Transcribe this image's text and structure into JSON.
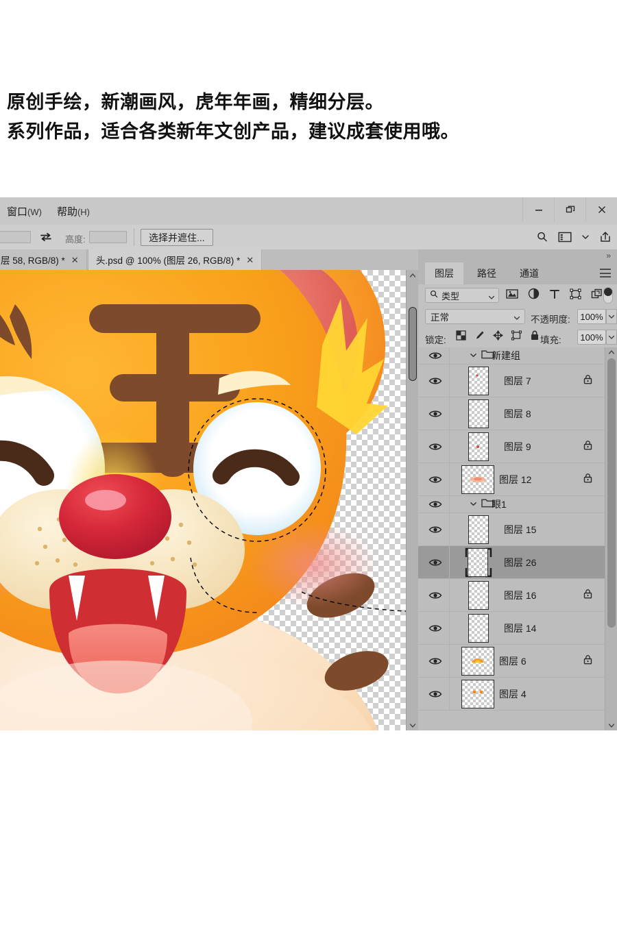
{
  "promo": {
    "line1": "原创手绘，新潮画风，虎年年画，精细分层。",
    "line2": "系列作品，适合各类新年文创产品，建议成套使用哦。"
  },
  "app": {
    "menubar": [
      {
        "label": "窗口",
        "mnemonic": "(W)"
      },
      {
        "label": "帮助",
        "mnemonic": "(H)"
      }
    ],
    "window_controls": [
      {
        "name": "minimize",
        "glyph": "—"
      },
      {
        "name": "restore",
        "glyph": "❐"
      },
      {
        "name": "close",
        "glyph": "✕"
      }
    ]
  },
  "options_bar": {
    "width_value": "",
    "swap_icon": "swap-arrows-icon",
    "height_label": "高度:",
    "height_value": "",
    "select_and_mask_button": "选择并遮住...",
    "right_icons": [
      "search-icon",
      "workspace-icon",
      "chevron-down-icon",
      "share-icon"
    ]
  },
  "tabs": [
    {
      "title": "层 58, RGB/8) *",
      "active": false,
      "close": "✕"
    },
    {
      "title": "头.psd @ 100% (图层 26, RGB/8) *",
      "active": true,
      "close": "✕"
    }
  ],
  "canvas": {
    "zoom": "100%",
    "selection": "elliptical-marching-ants",
    "artwork_colors": {
      "fur_orange": "#f9a01b",
      "fur_orange_deep": "#f5811f",
      "stripe_brown": "#7d4a2b",
      "ear_inner": "#e2655c",
      "nose_red": "#d6283a",
      "muzzle_cream": "#f6e3bd",
      "tongue_pink": "#f1746b",
      "mouth_red": "#cf2f33",
      "eye_white": "#ffffff",
      "eye_blue": "#cfeaf6",
      "body_cream": "#fbdfb9",
      "tuft_yellow": "#ffd634",
      "blush_pink": "#f2b2ad"
    }
  },
  "panel": {
    "collapse_arrow": "»",
    "tabs": [
      {
        "label": "图层",
        "active": true
      },
      {
        "label": "路径",
        "active": false
      },
      {
        "label": "通道",
        "active": false
      }
    ],
    "menu_icon": "hamburger-menu-icon",
    "filter": {
      "search_icon": "search-icon",
      "type_label": "类型",
      "chevron": "chevron-down-icon",
      "icons": [
        "pixel-layer-icon",
        "adjustment-layer-icon",
        "type-layer-icon",
        "shape-layer-icon",
        "smart-object-icon"
      ],
      "toggle_name": "filter-toggle"
    },
    "blend": {
      "mode": "正常",
      "opacity_label": "不透明度:",
      "opacity_value": "100%"
    },
    "lock": {
      "label": "锁定:",
      "icons": [
        "lock-transparency-icon",
        "lock-pixels-icon",
        "lock-position-icon",
        "lock-artboard-icon",
        "lock-all-icon"
      ],
      "fill_label": "填充:",
      "fill_value": "100%"
    },
    "layers": [
      {
        "name": "新建组",
        "type": "group",
        "visible": true,
        "locked": false,
        "selected": false,
        "expanded": true,
        "thumb": "empty"
      },
      {
        "name": "图层 7",
        "type": "layer",
        "visible": true,
        "locked": true,
        "selected": false,
        "thumb": "dot-red"
      },
      {
        "name": "图层 8",
        "type": "layer",
        "visible": true,
        "locked": false,
        "selected": false,
        "thumb": "empty"
      },
      {
        "name": "图层 9",
        "type": "layer",
        "visible": true,
        "locked": true,
        "selected": false,
        "thumb": "dot-red"
      },
      {
        "name": "图层 12",
        "type": "layer",
        "visible": true,
        "locked": true,
        "selected": false,
        "thumb": "peach-blob",
        "wide": true
      },
      {
        "name": "眼1",
        "type": "group",
        "visible": true,
        "locked": false,
        "selected": false,
        "expanded": true,
        "thumb": "empty"
      },
      {
        "name": "图层 15",
        "type": "layer",
        "visible": true,
        "locked": false,
        "selected": false,
        "thumb": "empty"
      },
      {
        "name": "图层 26",
        "type": "layer",
        "visible": true,
        "locked": false,
        "selected": true,
        "thumb": "empty"
      },
      {
        "name": "图层 16",
        "type": "layer",
        "visible": true,
        "locked": true,
        "selected": false,
        "thumb": "empty"
      },
      {
        "name": "图层 14",
        "type": "layer",
        "visible": true,
        "locked": false,
        "selected": false,
        "thumb": "empty"
      },
      {
        "name": "图层 6",
        "type": "layer",
        "visible": true,
        "locked": true,
        "selected": false,
        "thumb": "orange-arc",
        "wide": true
      },
      {
        "name": "图层 4",
        "type": "layer",
        "visible": true,
        "locked": false,
        "selected": false,
        "thumb": "orange-dots",
        "wide": true
      }
    ]
  }
}
